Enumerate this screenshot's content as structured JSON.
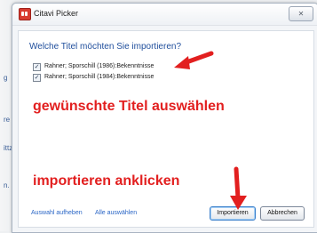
{
  "background_marks": [
    "g",
    "re",
    "ittz",
    "n."
  ],
  "window": {
    "title": "Citavi Picker",
    "close_glyph": "✕"
  },
  "question": "Welche Titel möchten Sie importieren?",
  "items": [
    {
      "label": "Rahner; Sporschill (1986):Bekenntnisse",
      "checked": true
    },
    {
      "label": "Rahner; Sporschill (1984):Bekenntnisse",
      "checked": true
    }
  ],
  "annotations": {
    "select_titles": "gewünschte Titel auswählen",
    "click_import": "importieren anklicken",
    "color": "#e21f1f"
  },
  "footer": {
    "deselect_link": "Auswahl aufheben",
    "select_all_link": "Alle auswählen",
    "import_button": "Importieren",
    "cancel_button": "Abbrechen"
  },
  "icons": {
    "checkbox_checked": "✓"
  }
}
